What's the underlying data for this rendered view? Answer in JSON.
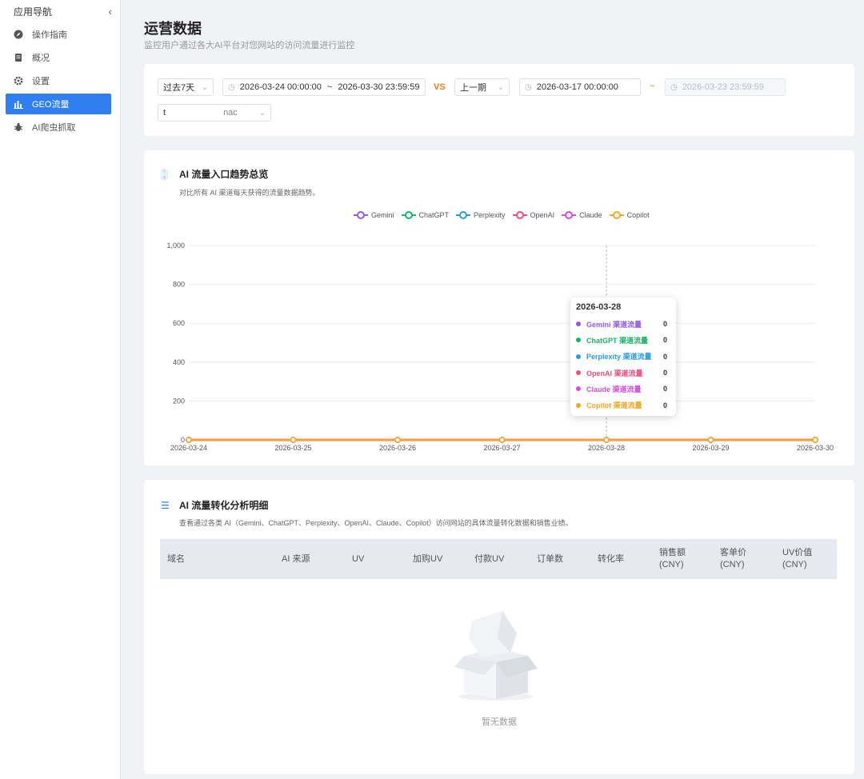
{
  "sidebar": {
    "title": "应用导航",
    "items": [
      {
        "label": "操作指南",
        "icon": "compass-icon"
      },
      {
        "label": "概况",
        "icon": "document-icon"
      },
      {
        "label": "设置",
        "icon": "gear-icon"
      },
      {
        "label": "GEO流量",
        "icon": "bar-chart-icon"
      },
      {
        "label": "AI爬虫抓取",
        "icon": "bug-icon"
      }
    ],
    "active_index": 3
  },
  "page": {
    "title": "运营数据",
    "subtitle": "监控用户通过各大AI平台对您网站的访问流量进行监控"
  },
  "filters": {
    "range_select": "过去7天",
    "range_start": "2026-03-24 00:00:00",
    "range_sep": "~",
    "range_end": "2026-03-30 23:59:59",
    "vs_label": "VS",
    "compare_select": "上一期",
    "compare_start": "2026-03-17 00:00:00",
    "compare_sep": "~",
    "compare_end": "2026-03-23 23:59:59",
    "domain_value": "t",
    "domain_suffix": "nac"
  },
  "trend": {
    "title": "AI 流量入口趋势总览",
    "subtitle": "对比所有 AI 渠道每天获得的流量数据趋势。",
    "tooltip_date": "2026-03-28",
    "tooltip_suffix": " 渠道流量"
  },
  "chart_data": {
    "type": "line",
    "x": [
      "2026-03-24",
      "2026-03-25",
      "2026-03-26",
      "2026-03-27",
      "2026-03-28",
      "2026-03-29",
      "2026-03-30"
    ],
    "ylim": [
      0,
      1000
    ],
    "yticks": [
      "0",
      "200",
      "400",
      "600",
      "800",
      "1,000"
    ],
    "grid": true,
    "legend_position": "top-center",
    "series": [
      {
        "name": "Gemini",
        "color": "#8e5be8",
        "values": [
          0,
          0,
          0,
          0,
          0,
          0,
          0
        ]
      },
      {
        "name": "ChatGPT",
        "color": "#19b36b",
        "values": [
          0,
          0,
          0,
          0,
          0,
          0,
          0
        ]
      },
      {
        "name": "Perplexity",
        "color": "#2b9be0",
        "values": [
          0,
          0,
          0,
          0,
          0,
          0,
          0
        ]
      },
      {
        "name": "OpenAI",
        "color": "#ee4f7c",
        "values": [
          0,
          0,
          0,
          0,
          0,
          0,
          0
        ]
      },
      {
        "name": "Claude",
        "color": "#d44ce0",
        "values": [
          0,
          0,
          0,
          0,
          0,
          0,
          0
        ]
      },
      {
        "name": "Copilot",
        "color": "#f5a623",
        "values": [
          0,
          0,
          0,
          0,
          0,
          0,
          0
        ]
      }
    ]
  },
  "table": {
    "title": "AI 流量转化分析明细",
    "subtitle": "查看通过各类 AI（Gemini、ChatGPT、Perplexity、OpenAI、Claude、Copilot）访问网站的具体流量转化数据和销售业绩。",
    "columns": [
      "域名",
      "AI 来源",
      "UV",
      "加购UV",
      "付款UV",
      "订单数",
      "转化率",
      "销售额\n(CNY)",
      "客单价\n(CNY)",
      "UV价值\n(CNY)"
    ],
    "empty_text": "暂无数据"
  }
}
